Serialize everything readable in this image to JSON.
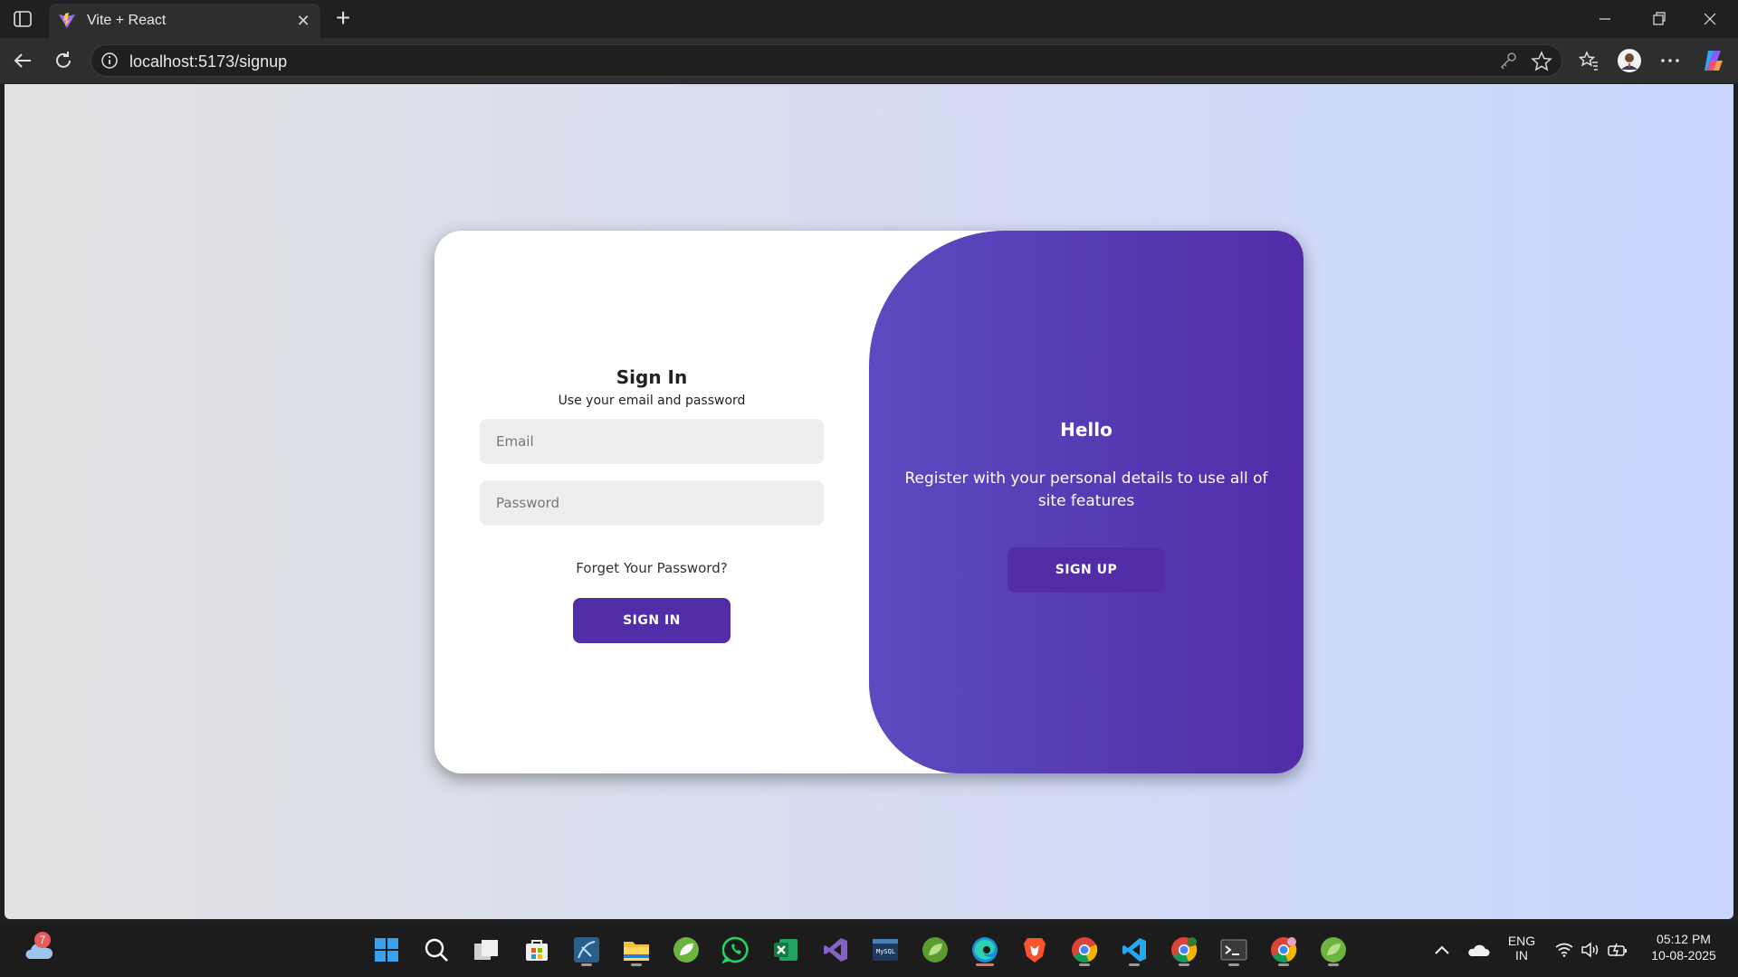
{
  "browser": {
    "tab_title": "Vite + React",
    "url": "localhost:5173/signup"
  },
  "signin": {
    "title": "Sign In",
    "subtitle": "Use your email and password",
    "email_placeholder": "Email",
    "password_placeholder": "Password",
    "forgot_link": "Forget Your Password?",
    "button_label": "SIGN IN"
  },
  "toggle": {
    "title": "Hello",
    "text": "Register with your personal details to use all of site features",
    "button_label": "SIGN UP"
  },
  "taskbar": {
    "weather_badge": "7",
    "apps": [
      "start-icon",
      "search-icon",
      "task-view-icon",
      "store-icon",
      "mysql-workbench-icon",
      "file-explorer-icon",
      "spring-tools-icon",
      "whatsapp-icon",
      "excel-icon",
      "visual-studio-icon",
      "mysql-shell-icon",
      "spring-tools-icon",
      "edge-icon",
      "brave-icon",
      "chrome-icon",
      "vscode-icon",
      "chrome-profile-icon",
      "terminal-icon",
      "chrome-profile-icon",
      "spring-tools-icon"
    ],
    "lang_top": "ENG",
    "lang_bottom": "IN",
    "time": "05:12 PM",
    "date": "10-08-2025"
  },
  "colors": {
    "accent": "#512da8",
    "panel_gradient_start": "#5c4bc0",
    "background_left": "#e2e2e2",
    "background_right": "#c9d6ff"
  }
}
